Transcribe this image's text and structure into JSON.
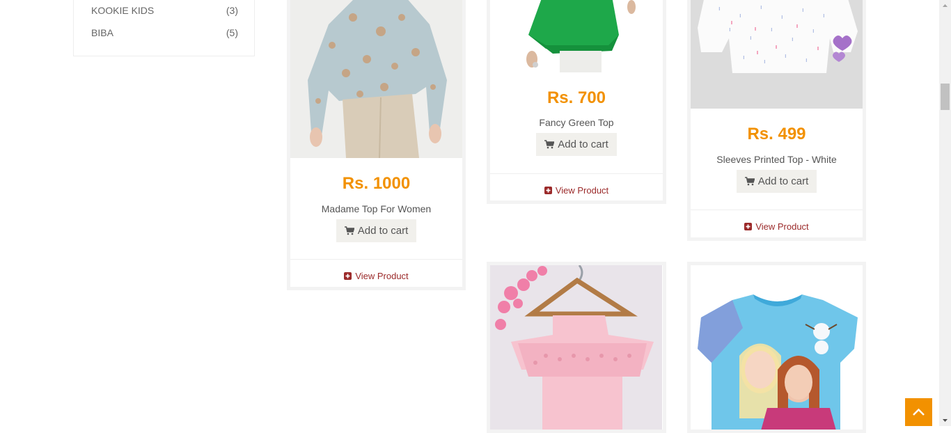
{
  "sidebar": {
    "brands": [
      {
        "name": "KOOKIE KIDS",
        "count": "(3)"
      },
      {
        "name": "BIBA",
        "count": "(5)"
      }
    ]
  },
  "products": [
    {
      "price": "Rs. 1000",
      "name": "Madame Top For Women",
      "cart_label": "Add to cart",
      "view_label": "View Product"
    },
    {
      "price": "Rs. 700",
      "name": "Fancy Green Top",
      "cart_label": "Add to cart",
      "view_label": "View Product"
    },
    {
      "price": "Rs. 499",
      "name": "Sleeves Printed Top - White",
      "cart_label": "Add to cart",
      "view_label": "View Product"
    }
  ],
  "colors": {
    "price": "#f29100",
    "view_link": "#9b2a2a",
    "cart_button_bg": "#f1f0ec",
    "back_to_top_bg": "#f29100"
  },
  "icons": {
    "cart": "shopping-cart-icon",
    "view": "plus-square-icon",
    "back_to_top": "chevron-up-icon"
  }
}
